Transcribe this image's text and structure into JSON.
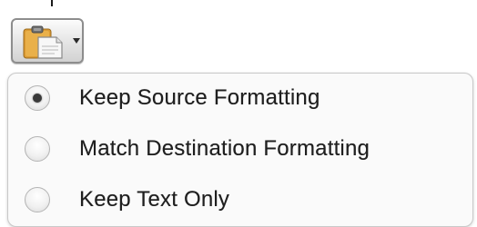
{
  "paste_button": {
    "icon": "clipboard-paste-icon",
    "dropdown_icon": "caret-down-icon"
  },
  "menu": {
    "items": [
      {
        "label": "Keep Source Formatting",
        "selected": true
      },
      {
        "label": "Match Destination Formatting",
        "selected": false
      },
      {
        "label": "Keep Text Only",
        "selected": false
      }
    ]
  },
  "colors": {
    "clipboard": "#e0a43a",
    "paper": "#f7f7f7",
    "text": "#1f1f1f",
    "menu_bg": "#fafafa"
  }
}
